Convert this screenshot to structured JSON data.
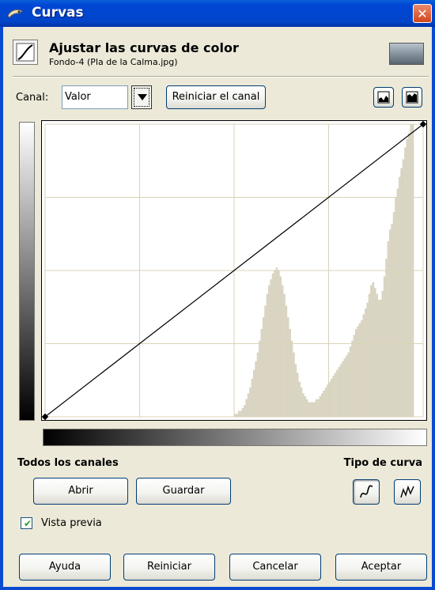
{
  "window": {
    "title": "Curvas",
    "close_label": "✕"
  },
  "header": {
    "title": "Ajustar las curvas de color",
    "subtitle": "Fondo-4 (Pla de la Calma.jpg)"
  },
  "channel": {
    "label": "Canal:",
    "value": "Valor",
    "reset_label": "Reiniciar el canal"
  },
  "sections": {
    "all_channels": "Todos los canales",
    "curve_type": "Tipo de curva"
  },
  "buttons": {
    "open": "Abrir",
    "save": "Guardar",
    "help": "Ayuda",
    "reset": "Reiniciar",
    "cancel": "Cancelar",
    "ok": "Aceptar"
  },
  "preview": {
    "label": "Vista previa",
    "checked": true
  },
  "colors": {
    "titlebar": "#0046d5",
    "histogram_fill": "#d9d5c2",
    "grid": "#d9d3b8",
    "curve": "#000000"
  },
  "histogram": {
    "bins": [
      0,
      0,
      0,
      0,
      0,
      0,
      0,
      0,
      0,
      0,
      0,
      0,
      0,
      0,
      0,
      0,
      0,
      0,
      0,
      0,
      0,
      0,
      0,
      0,
      0,
      0,
      0,
      0,
      0,
      0,
      0,
      0,
      0,
      0,
      0,
      0,
      0,
      0,
      0,
      0,
      0,
      0,
      0,
      0,
      0,
      0,
      0,
      0,
      0,
      0,
      0,
      0,
      0,
      0,
      0,
      0,
      0,
      0,
      0,
      0,
      0,
      0,
      0,
      0,
      0,
      0,
      0,
      0,
      0,
      0,
      0,
      0,
      0,
      0,
      0,
      0,
      0,
      0,
      0,
      0,
      0,
      0,
      0,
      0,
      0,
      0,
      0,
      0,
      0,
      0,
      0,
      0,
      0,
      0,
      0,
      0,
      0,
      0,
      0,
      0,
      1,
      1,
      2,
      2,
      3,
      4,
      6,
      8,
      10,
      13,
      16,
      19,
      22,
      26,
      30,
      34,
      38,
      42,
      45,
      47,
      49,
      50,
      51,
      50,
      48,
      45,
      42,
      38,
      34,
      30,
      26,
      22,
      18,
      15,
      12,
      10,
      8,
      7,
      6,
      5,
      5,
      5,
      5,
      6,
      6,
      7,
      8,
      9,
      10,
      11,
      12,
      13,
      14,
      15,
      16,
      17,
      18,
      19,
      20,
      21,
      22,
      24,
      26,
      28,
      30,
      31,
      32,
      33,
      35,
      37,
      39,
      42,
      45,
      46,
      44,
      42,
      40,
      40,
      43,
      48,
      54,
      60,
      64,
      66,
      70,
      75,
      78,
      82,
      85,
      88,
      92,
      95,
      97,
      100,
      100,
      0,
      0,
      0,
      0,
      0
    ]
  },
  "curve": {
    "points": [
      [
        0,
        0
      ],
      [
        255,
        255
      ]
    ]
  }
}
